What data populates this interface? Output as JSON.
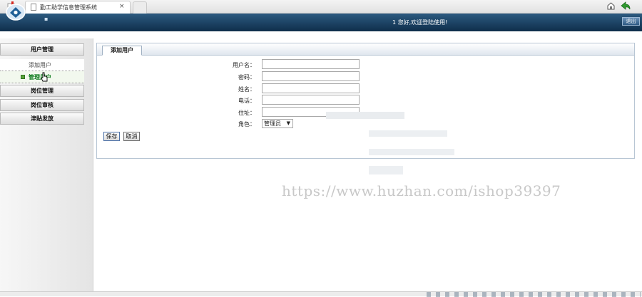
{
  "browser": {
    "tab_title": "勤工助学信息管理系统",
    "tab_close": "×"
  },
  "header": {
    "welcome": "1 您好,欢迎登陆使用!",
    "logout": "退出",
    "dot": "▪"
  },
  "sidebar": {
    "menus": [
      {
        "label": "用户管理"
      },
      {
        "label": "岗位管理"
      },
      {
        "label": "岗位审核"
      },
      {
        "label": "津贴发放"
      }
    ],
    "submenus": [
      {
        "label": "添加用户"
      },
      {
        "label": "管理用户"
      }
    ]
  },
  "form": {
    "tab": "添加用户",
    "fields": [
      {
        "label": "用户名：",
        "value": ""
      },
      {
        "label": "密码：",
        "value": ""
      },
      {
        "label": "姓名：",
        "value": ""
      },
      {
        "label": "电话：",
        "value": ""
      },
      {
        "label": "住址：",
        "value": ""
      }
    ],
    "role_label": "角色：",
    "role_value": "管理员",
    "role_caret": "▼",
    "save": "保存",
    "cancel": "取消"
  },
  "watermark": "https://www.huzhan.com/ishop39397",
  "colors": {
    "header_dark": "#0f2e4b",
    "active_menu": "#0b7a1a"
  }
}
